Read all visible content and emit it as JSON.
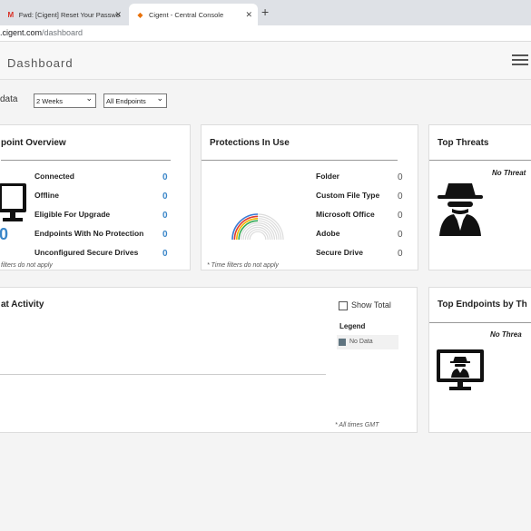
{
  "browser": {
    "tabs": [
      {
        "label": "Fwd: [Cigent] Reset Your Passwo",
        "icon": "gmail-icon"
      },
      {
        "label": "Cigent - Central Console",
        "icon": "cigent-icon"
      }
    ],
    "new_tab": "+",
    "url_host": ".cigent.com",
    "url_path": "/dashboard"
  },
  "header": {
    "title": "Dashboard"
  },
  "filters": {
    "label": "data",
    "time_range": "2 Weeks",
    "endpoints": "All Endpoints"
  },
  "endpoint_overview": {
    "title": "point Overview",
    "big_value": "0",
    "rows": [
      {
        "label": "Connected",
        "value": "0"
      },
      {
        "label": "Offline",
        "value": "0"
      },
      {
        "label": "Eligible For Upgrade",
        "value": "0"
      },
      {
        "label": "Endpoints With No Protection",
        "value": "0"
      },
      {
        "label": "Unconfigured Secure Drives",
        "value": "0"
      }
    ],
    "note": "filters do not apply"
  },
  "protections": {
    "title": "Protections In Use",
    "rows": [
      {
        "label": "Folder",
        "value": "0"
      },
      {
        "label": "Custom File Type",
        "value": "0"
      },
      {
        "label": "Microsoft Office",
        "value": "0"
      },
      {
        "label": "Adobe",
        "value": "0"
      },
      {
        "label": "Secure Drive",
        "value": "0"
      }
    ],
    "note": "* Time filters do not apply",
    "arc_colors": [
      "#3a7bd5",
      "#e03b2f",
      "#f2b705",
      "#34a853"
    ]
  },
  "top_threats": {
    "title": "Top Threats",
    "empty": "No Threat"
  },
  "threat_activity": {
    "title": "at Activity",
    "show_total": "Show Total",
    "legend_title": "Legend",
    "legend_item": "No Data",
    "legend_color": "#5f7480",
    "note": "* All times GMT"
  },
  "top_endpoints": {
    "title": "Top Endpoints by Th",
    "empty": "No Threa"
  }
}
